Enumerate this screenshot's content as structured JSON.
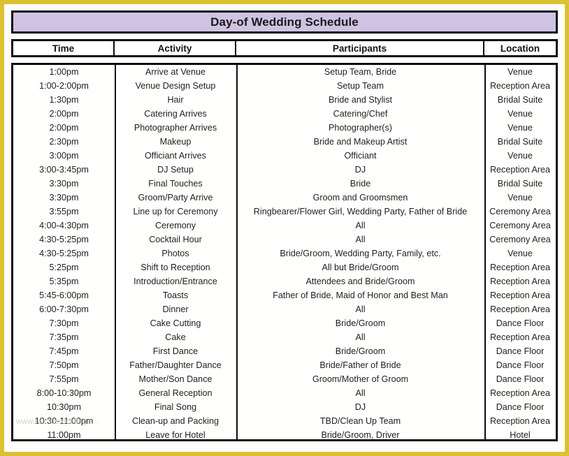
{
  "document": {
    "title": "Day-of Wedding Schedule",
    "border_color": "#dcc132",
    "title_bg_color": "#cfc3e3",
    "watermark": "www.tearsandcollege..."
  },
  "table": {
    "columns": [
      "Time",
      "Activity",
      "Participants",
      "Location"
    ],
    "rows": [
      {
        "time": "1:00pm",
        "activity": "Arrive at Venue",
        "participants": "Setup Team, Bride",
        "location": "Venue"
      },
      {
        "time": "1:00-2:00pm",
        "activity": "Venue Design Setup",
        "participants": "Setup Team",
        "location": "Reception Area"
      },
      {
        "time": "1:30pm",
        "activity": "Hair",
        "participants": "Bride and Stylist",
        "location": "Bridal Suite"
      },
      {
        "time": "2:00pm",
        "activity": "Catering Arrives",
        "participants": "Catering/Chef",
        "location": "Venue"
      },
      {
        "time": "2:00pm",
        "activity": "Photographer Arrives",
        "participants": "Photographer(s)",
        "location": "Venue"
      },
      {
        "time": "2:30pm",
        "activity": "Makeup",
        "participants": "Bride and Makeup Artist",
        "location": "Bridal Suite"
      },
      {
        "time": "3:00pm",
        "activity": "Officiant Arrives",
        "participants": "Officiant",
        "location": "Venue"
      },
      {
        "time": "3:00-3:45pm",
        "activity": "DJ Setup",
        "participants": "DJ",
        "location": "Reception Area"
      },
      {
        "time": "3:30pm",
        "activity": "Final Touches",
        "participants": "Bride",
        "location": "Bridal Suite"
      },
      {
        "time": "3:30pm",
        "activity": "Groom/Party Arrive",
        "participants": "Groom and Groomsmen",
        "location": "Venue"
      },
      {
        "time": "3:55pm",
        "activity": "Line up for Ceremony",
        "participants": "Ringbearer/Flower Girl, Wedding Party, Father of Bride",
        "location": "Ceremony Area"
      },
      {
        "time": "4:00-4:30pm",
        "activity": "Ceremony",
        "participants": "All",
        "location": "Ceremony Area"
      },
      {
        "time": "4:30-5:25pm",
        "activity": "Cocktail Hour",
        "participants": "All",
        "location": "Ceremony Area"
      },
      {
        "time": "4:30-5:25pm",
        "activity": "Photos",
        "participants": "Bride/Groom, Wedding Party, Family, etc.",
        "location": "Venue"
      },
      {
        "time": "5:25pm",
        "activity": "Shift to Reception",
        "participants": "All but Bride/Groom",
        "location": "Reception Area"
      },
      {
        "time": "5:35pm",
        "activity": "Introduction/Entrance",
        "participants": "Attendees and Bride/Groom",
        "location": "Reception Area"
      },
      {
        "time": "5:45-6:00pm",
        "activity": "Toasts",
        "participants": "Father of Bride, Maid of Honor and Best Man",
        "location": "Reception Area"
      },
      {
        "time": "6:00-7:30pm",
        "activity": "Dinner",
        "participants": "All",
        "location": "Reception Area"
      },
      {
        "time": "7:30pm",
        "activity": "Cake Cutting",
        "participants": "Bride/Groom",
        "location": "Dance Floor"
      },
      {
        "time": "7:35pm",
        "activity": "Cake",
        "participants": "All",
        "location": "Reception Area"
      },
      {
        "time": "7:45pm",
        "activity": "First Dance",
        "participants": "Bride/Groom",
        "location": "Dance Floor"
      },
      {
        "time": "7:50pm",
        "activity": "Father/Daughter Dance",
        "participants": "Bride/Father of Bride",
        "location": "Dance Floor"
      },
      {
        "time": "7:55pm",
        "activity": "Mother/Son Dance",
        "participants": "Groom/Mother of Groom",
        "location": "Dance Floor"
      },
      {
        "time": "8:00-10:30pm",
        "activity": "General Reception",
        "participants": "All",
        "location": "Reception Area"
      },
      {
        "time": "10:30pm",
        "activity": "Final Song",
        "participants": "DJ",
        "location": "Dance Floor"
      },
      {
        "time": "10:30-11:00pm",
        "activity": "Clean-up and Packing",
        "participants": "TBD/Clean Up Team",
        "location": "Reception Area"
      },
      {
        "time": "11:00pm",
        "activity": "Leave for Hotel",
        "participants": "Bride/Groom, Driver",
        "location": "Hotel"
      }
    ]
  }
}
